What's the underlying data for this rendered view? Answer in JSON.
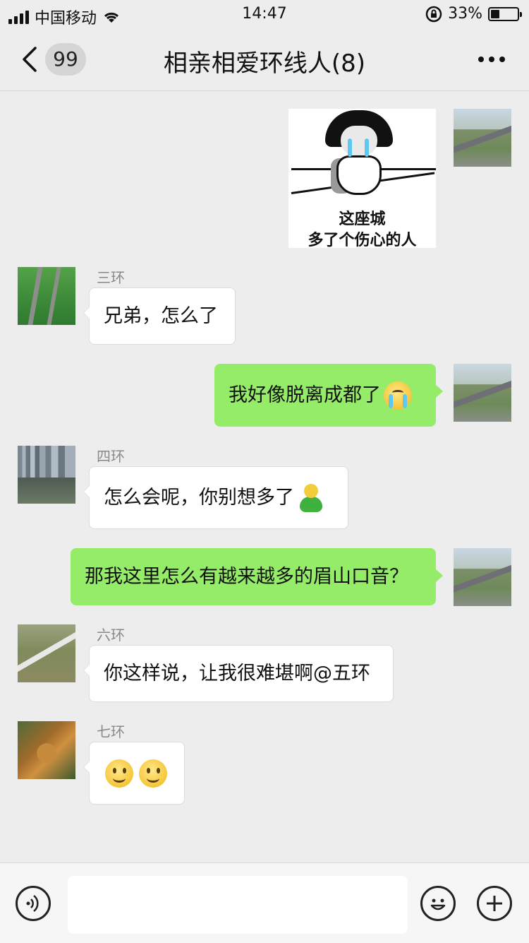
{
  "status_bar": {
    "carrier": "中国移动",
    "time": "14:47",
    "battery_percent": "33%",
    "battery_level": 0.33
  },
  "nav": {
    "unread_count": "99",
    "title": "相亲相爱环线人(8)"
  },
  "messages": [
    {
      "kind": "sticker",
      "side": "out",
      "caption_line1": "这座城",
      "caption_line2": "多了个伤心的人",
      "avatar": "aerial-road-avatar"
    },
    {
      "kind": "text",
      "side": "in",
      "sender": "三环",
      "text": "兄弟，怎么了",
      "avatar": "green-road-avatar"
    },
    {
      "kind": "text",
      "side": "out",
      "text": "我好像脱离成都了",
      "emoji": "crying-emoji",
      "avatar": "aerial-road-avatar"
    },
    {
      "kind": "text",
      "side": "in",
      "sender": "四环",
      "text": "怎么会呢，你别想多了",
      "emoji": "green-figure-emoji",
      "avatar": "city-road-avatar"
    },
    {
      "kind": "text",
      "side": "out",
      "text": "那我这里怎么有越来越多的眉山口音？",
      "avatar": "aerial-road-avatar"
    },
    {
      "kind": "text",
      "side": "in",
      "sender": "六环",
      "text": "你这样说，让我很难堪啊@五环",
      "avatar": "ring-road-avatar"
    },
    {
      "kind": "emoji",
      "side": "in",
      "sender": "七环",
      "emojis": [
        "smiley-emoji",
        "smiley-emoji"
      ],
      "avatar": "interchange-avatar"
    }
  ],
  "input_bar": {
    "left_icon": "voice-icon",
    "right_icons": [
      "emoji-icon",
      "plus-icon"
    ]
  },
  "colors": {
    "background": "#ededed",
    "outgoing_bubble": "#95ec69",
    "incoming_bubble": "#ffffff"
  }
}
